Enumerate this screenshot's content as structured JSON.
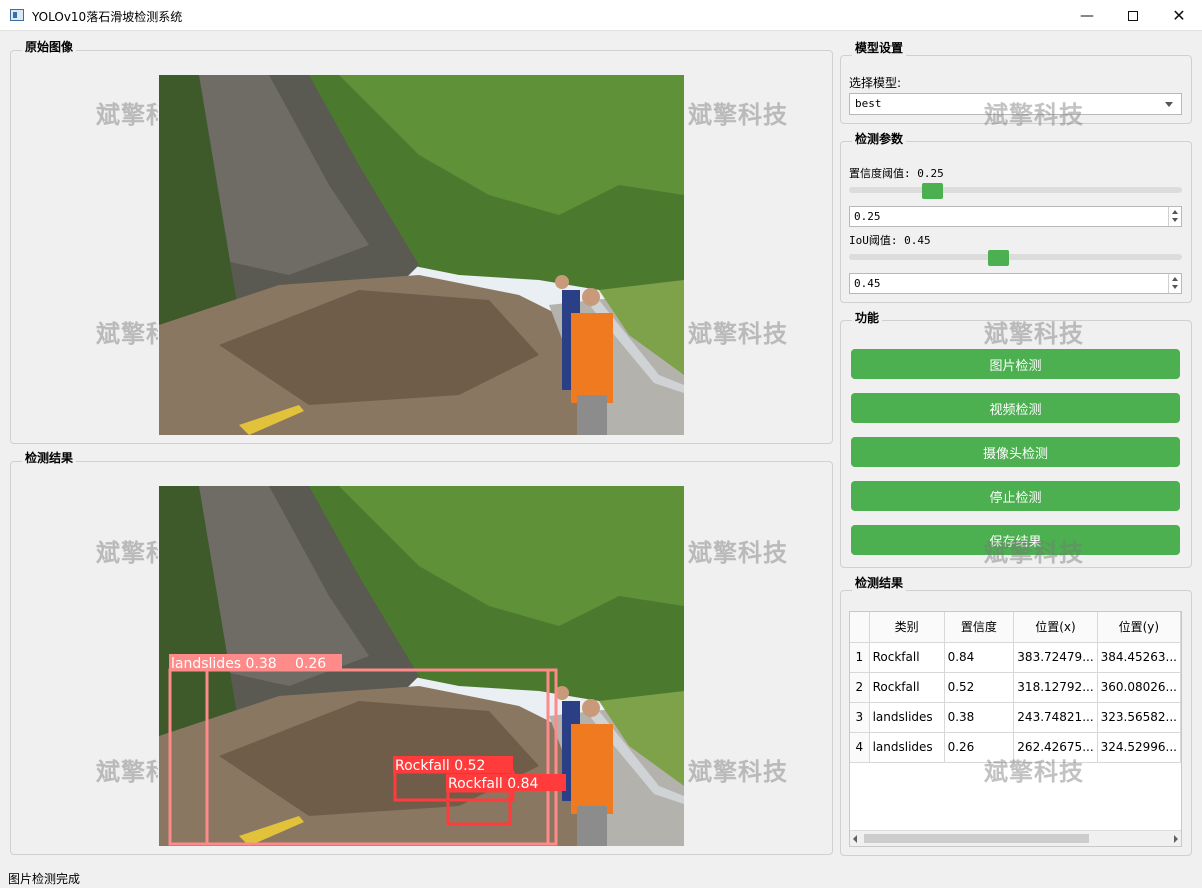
{
  "window": {
    "title": "YOLOv10落石滑坡检测系统"
  },
  "original_panel": {
    "title": "原始图像"
  },
  "result_panel": {
    "title": "检测结果",
    "detections": [
      {
        "label": "landslides 0.38"
      },
      {
        "label": "0.26"
      },
      {
        "label": "Rockfall 0.52"
      },
      {
        "label": "Rockfall 0.84"
      }
    ]
  },
  "watermark": "斌擎科技",
  "model_settings": {
    "title": "模型设置",
    "select_label": "选择模型:",
    "selected_model": "best"
  },
  "detection_params": {
    "title": "检测参数",
    "conf_label": "置信度阈值: 0.25",
    "conf_value": 0.25,
    "conf_spin": "0.25",
    "iou_label": "IoU阈值: 0.45",
    "iou_value": 0.45,
    "iou_spin": "0.45"
  },
  "functions": {
    "title": "功能",
    "image_btn": "图片检测",
    "video_btn": "视频检测",
    "camera_btn": "摄像头检测",
    "stop_btn": "停止检测",
    "save_btn": "保存结果"
  },
  "results": {
    "title": "检测结果",
    "headers": [
      "类别",
      "置信度",
      "位置(x)",
      "位置(y)"
    ],
    "rows": [
      {
        "num": "1",
        "cls": "Rockfall",
        "conf": "0.84",
        "x": "383.72479...",
        "y": "384.45263..."
      },
      {
        "num": "2",
        "cls": "Rockfall",
        "conf": "0.52",
        "x": "318.12792...",
        "y": "360.08026..."
      },
      {
        "num": "3",
        "cls": "landslides",
        "conf": "0.38",
        "x": "243.74821...",
        "y": "323.56582..."
      },
      {
        "num": "4",
        "cls": "landslides",
        "conf": "0.26",
        "x": "262.42675...",
        "y": "324.52996..."
      }
    ]
  },
  "status": {
    "text": "图片检测完成"
  },
  "colors": {
    "accent": "#4caf50",
    "box_landslide": "#ff8a8a",
    "box_rockfall": "#ff3b3b"
  }
}
